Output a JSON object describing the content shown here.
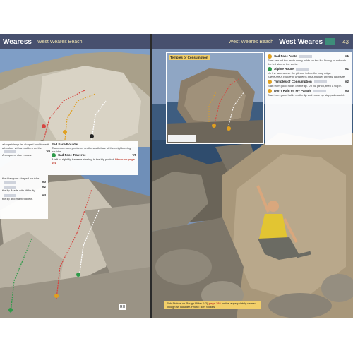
{
  "colors": {
    "header_bg": "#47506e",
    "header_sub": "#f0e3b0",
    "accent_yellow": "#f2cf6a",
    "route_red": "#d64540",
    "route_yellow": "#e0a020",
    "route_green": "#2f9a4a",
    "route_black": "#222222",
    "ref_red": "#c0392b"
  },
  "left_page": {
    "header": {
      "title": "Wearess",
      "subtitle": "West Weares Beach"
    },
    "upper_panel": {
      "intro": "a large triangular-shaped boulder with a boulder with a problem on the",
      "route_1": {
        "grade": "V0",
        "desc": "A couple of nice moves."
      },
      "sad_face_boulder": {
        "name": "Sad Face Boulder",
        "desc": "There are more problems on the south face of the neighbouring boulder."
      },
      "sad_face_traverse": {
        "name": "Sad Face Traverse",
        "grade": "V5",
        "desc": "A left-to-right lip traverse starting in the big pocket.",
        "ref": "Photo on page 191"
      }
    },
    "lower_panel": {
      "intro": "the triangular-shaped boulder",
      "route_1": {
        "grade": "V0",
        "desc": ""
      },
      "route_2": {
        "grade": "V2",
        "desc": "the lip. Made with difficulty."
      },
      "route_3": {
        "grade": "V4",
        "desc": "the lip and mantel direct."
      }
    },
    "logo_text": "RH"
  },
  "right_page": {
    "header": {
      "subtitle": "West Weares Beach",
      "title": "West Weares",
      "page_number": "43"
    },
    "inset": {
      "label": "Temples of Consumption"
    },
    "routes": [
      {
        "num": "1",
        "name": "Sad Face Arete",
        "grade": "V1",
        "color": "#e0a020",
        "desc": "Start around the arete using holds on the lip. Swing round onto the left side of the arete."
      },
      {
        "num": "2",
        "name": "Alpine Route",
        "grade": "V1",
        "color": "#2f9a4a",
        "desc": "Up the face above the pit and follow the long ridge.",
        "note": "There are a couple of problems on a boulder directly opposite."
      },
      {
        "num": "3",
        "name": "Temples of Consumption",
        "grade": "V2",
        "color": "#e0a020",
        "desc": "Start from good holds on the lip. Up via pinch, then a slope."
      },
      {
        "num": "4",
        "name": "Don't Rain on My Parade",
        "grade": "V3",
        "color": "#e0a020",
        "desc": "Start from good holds on the lip and move up stepped mantel."
      }
    ],
    "caption": {
      "text": "Rob Stokes on Rough Rider (V2)",
      "ref": "page 192",
      "tail": "on the appropriately named Trough As Boulder. Photo: Ben Stokes"
    }
  }
}
